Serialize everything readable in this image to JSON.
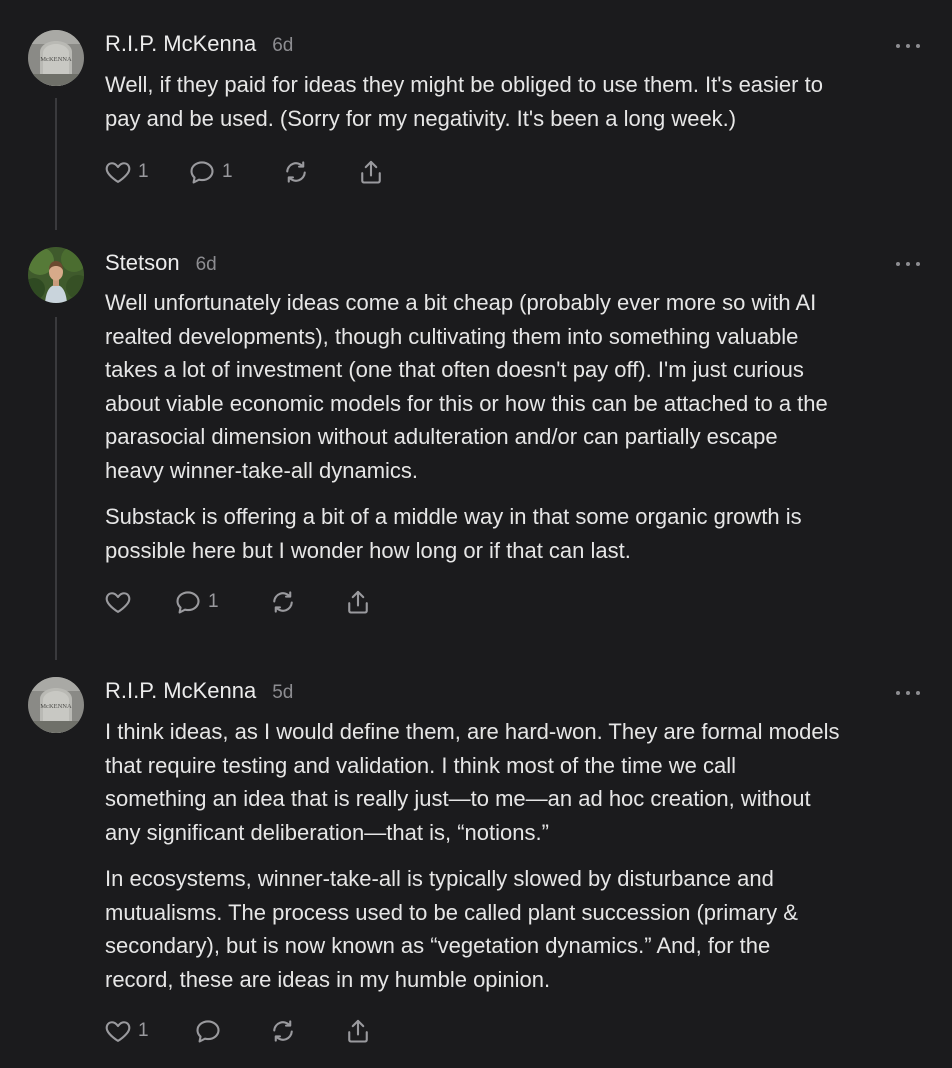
{
  "comments": [
    {
      "author": "R.I.P. McKenna",
      "time": "6d",
      "avatar_label": "McKENNA",
      "paragraphs": [
        "Well, if they paid for ideas they might be obliged to use them. It's easier to\npay and be used. (Sorry for my negativity. It's been a long week.)"
      ],
      "likes": "1",
      "replies": "1"
    },
    {
      "author": "Stetson",
      "time": "6d",
      "paragraphs": [
        "Well unfortunately ideas come a bit cheap (probably ever more so with AI\nrealted developments), though cultivating them into something valuable\ntakes a lot of investment (one that often doesn't pay off). I'm just curious\nabout viable economic models for this or how this can be attached to a the\nparasocial dimension without adulteration and/or can partially escape\nheavy winner-take-all dynamics.",
        "Substack is offering a bit of a middle way in that some organic growth is\npossible here but I wonder how long or if that can last."
      ],
      "likes": "",
      "replies": "1"
    },
    {
      "author": "R.I.P. McKenna",
      "time": "5d",
      "avatar_label": "McKENNA",
      "paragraphs": [
        "I think ideas, as I would define them, are hard-won. They are formal models\nthat require testing and validation. I think most of the time we call\nsomething an idea that is really just—to me—an ad hoc creation, without\nany significant deliberation—that is, “notions.”",
        "In ecosystems, winner-take-all is typically slowed by disturbance and\nmutualisms. The process used to be called plant succession (primary &\nsecondary), but is now known as “vegetation dynamics.” And, for the\nrecord, these are ideas in my humble opinion."
      ],
      "likes": "1",
      "replies": ""
    }
  ],
  "colors": {
    "background": "#1b1b1d",
    "text": "#e6e6e6",
    "muted": "#8d8d91",
    "icon": "#9a9a9e",
    "thread_line": "#3a3a3d"
  },
  "icons": [
    "heart-icon",
    "comment-icon",
    "restack-icon",
    "share-icon",
    "more-options-icon"
  ]
}
